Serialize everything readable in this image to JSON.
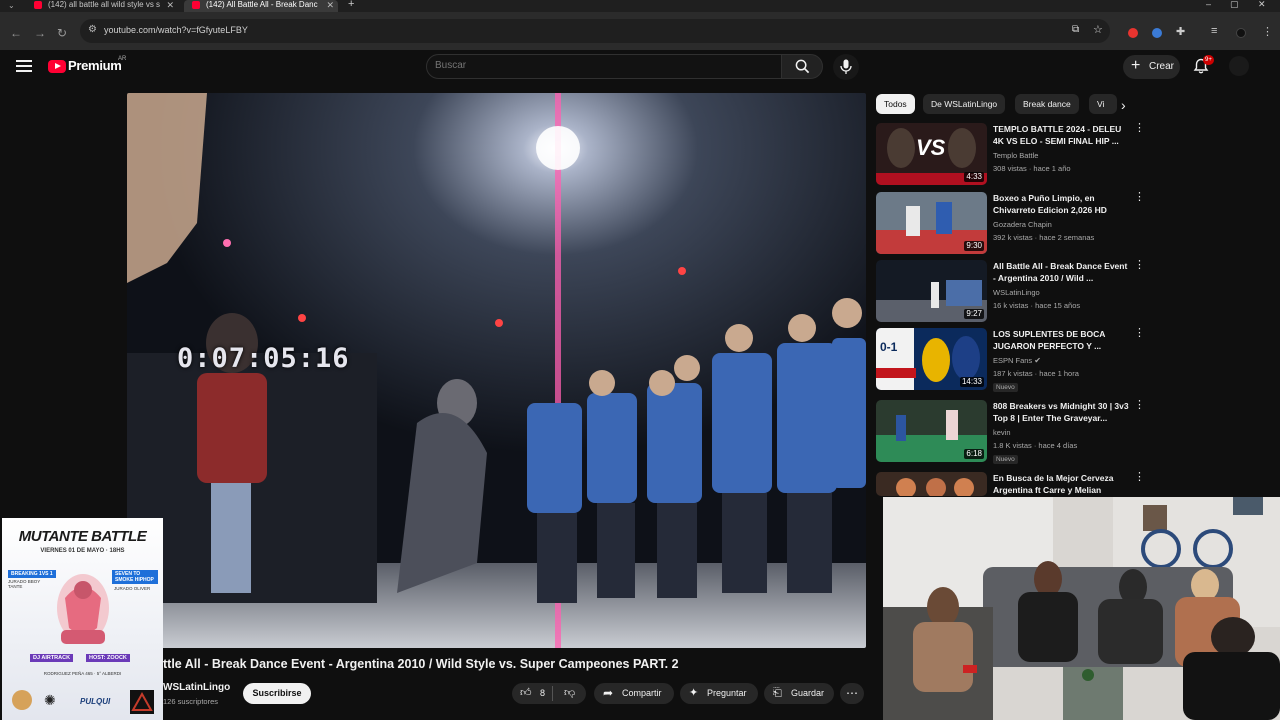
{
  "browser": {
    "tabs": [
      {
        "title": "(142) all battle all wild style vs s"
      },
      {
        "title": "(142) All Battle All - Break Danc"
      }
    ],
    "url": "youtube.com/watch?v=fGfyuteLFBY"
  },
  "header": {
    "logo_text": "Premium",
    "region": "AR",
    "search_placeholder": "Buscar",
    "create_label": "Crear",
    "notifications_badge": "9+"
  },
  "video": {
    "timestamp_overlay": "0:07:05:16",
    "title": "ttle All - Break Dance Event - Argentina 2010 / Wild Style vs. Super Campeones PART. 2",
    "channel": "WSLatinLingo",
    "subscribers": "126 suscriptores",
    "subscribe_label": "Suscribirse",
    "likes": "8",
    "share_label": "Compartir",
    "ask_label": "Preguntar",
    "save_label": "Guardar"
  },
  "chips": [
    "Todos",
    "De WSLatinLingo",
    "Break dance",
    "Vi"
  ],
  "recommended": [
    {
      "title": "TEMPLO BATTLE 2024 - DELEU 4K VS ELO - SEMI FINAL HIP ...",
      "channel": "Templo Battle",
      "meta": "308 vistas · hace 1 año",
      "duration": "4:33",
      "thumb_text": "VS",
      "color_a": "#2a1a1a",
      "color_b": "#b01020"
    },
    {
      "title": "Boxeo a Puño Limpio, en Chivarreto Edicion 2,026 HD",
      "channel": "Gozadera Chapin",
      "meta": "392 k vistas · hace 2 semanas",
      "duration": "9:30",
      "thumb_text": "",
      "color_a": "#6c7a88",
      "color_b": "#c23b3b"
    },
    {
      "title": "All Battle All - Break Dance Event - Argentina 2010 / Wild ...",
      "channel": "WSLatinLingo",
      "meta": "16 k vistas · hace 15 años",
      "duration": "9:27",
      "thumb_text": "",
      "color_a": "#141a24",
      "color_b": "#4b6ea8"
    },
    {
      "title": "LOS SUPLENTES DE BOCA JUGARON PERFECTO Y ...",
      "channel": "ESPN Fans",
      "meta": "187 k vistas · hace 1 hora",
      "duration": "14:33",
      "badge": "Nuevo",
      "thumb_text": "0-1",
      "color_a": "#0b2a5c",
      "color_b": "#e8b400"
    },
    {
      "title": "808 Breakers vs Midnight 30 | 3v3 Top 8 | Enter The Graveyar...",
      "channel": "kevin",
      "meta": "1.8 K vistas · hace 4 días",
      "duration": "6:18",
      "badge": "Nuevo",
      "thumb_text": "",
      "color_a": "#2b3b2f",
      "color_b": "#2e8b57"
    },
    {
      "title": "En Busca de la Mejor Cerveza Argentina ft Carre y Melian",
      "channel": "",
      "meta": "",
      "duration": "",
      "thumb_text": "",
      "color_a": "#3a2a22",
      "color_b": "#d08050"
    }
  ],
  "overlays": {
    "poster": {
      "title": "MUTANTE BATTLE",
      "date": "VIERNES 01 DE MAYO · 18HS",
      "tag_left": "BREAKING 1VS 1",
      "tag_left_sub": "JURADO BBOY TANTE",
      "tag_right": "SEVEN TO SMOKE HIPHOP",
      "tag_right_sub": "JURADO OLIVER",
      "dj": "DJ AIRTRACK",
      "host": "HOST: ZOOCK",
      "address": "RODRIGUEZ PEÑA 465 · 5° ALBERDI",
      "brand": "PULQUI"
    },
    "webcam_label": "webcam"
  },
  "colors": {
    "brand_red": "#ff0033",
    "bg": "#0f0f0f",
    "chip_bg": "#272727"
  }
}
